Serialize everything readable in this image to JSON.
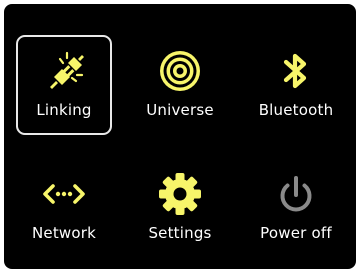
{
  "menu": {
    "items": [
      {
        "label": "Linking",
        "icon": "plug-disconnect-icon",
        "selected": true
      },
      {
        "label": "Universe",
        "icon": "target-icon",
        "selected": false
      },
      {
        "label": "Bluetooth",
        "icon": "bluetooth-icon",
        "selected": false
      },
      {
        "label": "Network",
        "icon": "network-code-icon",
        "selected": false
      },
      {
        "label": "Settings",
        "icon": "gear-icon",
        "selected": false
      },
      {
        "label": "Power off",
        "icon": "power-icon",
        "selected": false
      }
    ]
  },
  "colors": {
    "background": "#000000",
    "icon_accent": "#f7f56a",
    "icon_muted": "#8a8a8a",
    "label": "#ffffff",
    "selection_border": "#e8e8e8"
  }
}
